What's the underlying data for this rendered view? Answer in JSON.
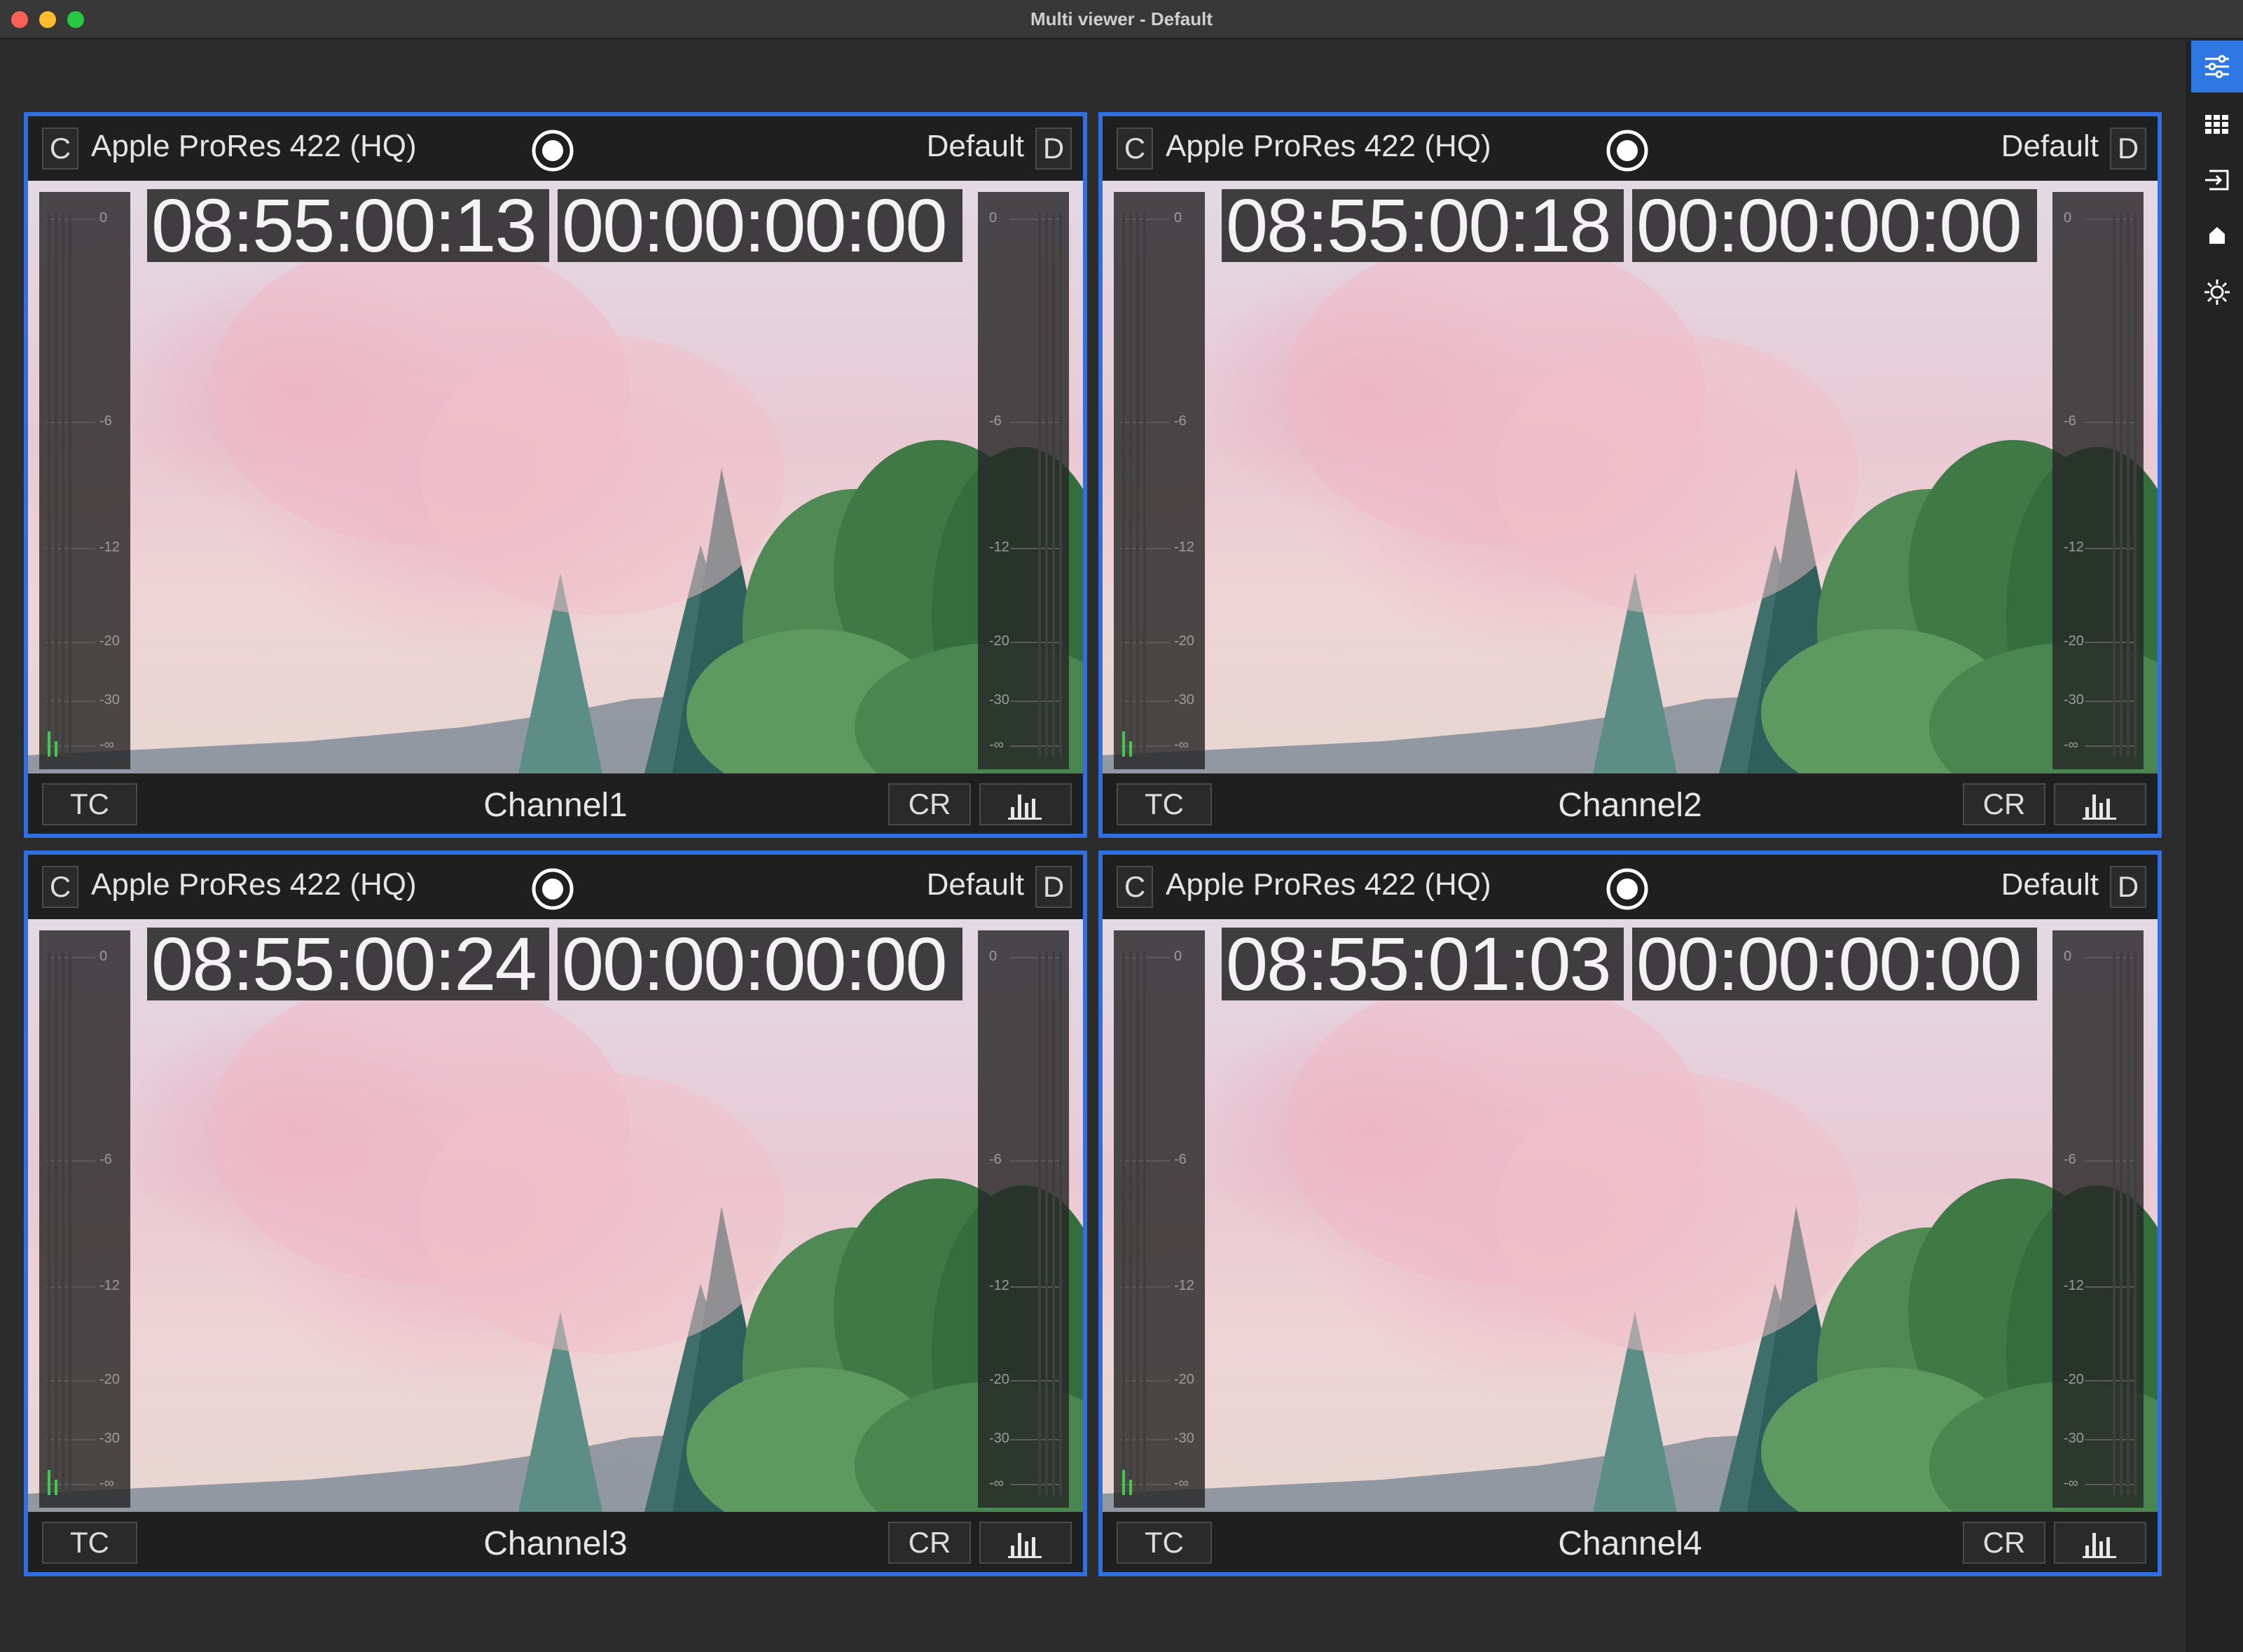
{
  "window": {
    "title": "Multi viewer - Default"
  },
  "toolbar": {
    "icons": [
      "sliders-icon",
      "grid-icon",
      "input-icon",
      "home-icon",
      "gear-icon"
    ],
    "accent": "#2f78e3"
  },
  "tile_common": {
    "c_label": "C",
    "d_label": "D",
    "tc_label": "TC",
    "cr_label": "CR",
    "border_color": "#2f6fe0",
    "meter_scale": [
      "0",
      "-6",
      "-12",
      "-20",
      "-30",
      "-∞"
    ]
  },
  "tiles": [
    {
      "codec": "Apple ProRes 422 (HQ)",
      "profile": "Default",
      "timecode": "08:55:00:13",
      "timecode2": "00:00:00:00",
      "channel": "Channel1"
    },
    {
      "codec": "Apple ProRes 422 (HQ)",
      "profile": "Default",
      "timecode": "08:55:00:18",
      "timecode2": "00:00:00:00",
      "channel": "Channel2"
    },
    {
      "codec": "Apple ProRes 422 (HQ)",
      "profile": "Default",
      "timecode": "08:55:00:24",
      "timecode2": "00:00:00:00",
      "channel": "Channel3"
    },
    {
      "codec": "Apple ProRes 422 (HQ)",
      "profile": "Default",
      "timecode": "08:55:01:03",
      "timecode2": "00:00:00:00",
      "channel": "Channel4"
    }
  ]
}
